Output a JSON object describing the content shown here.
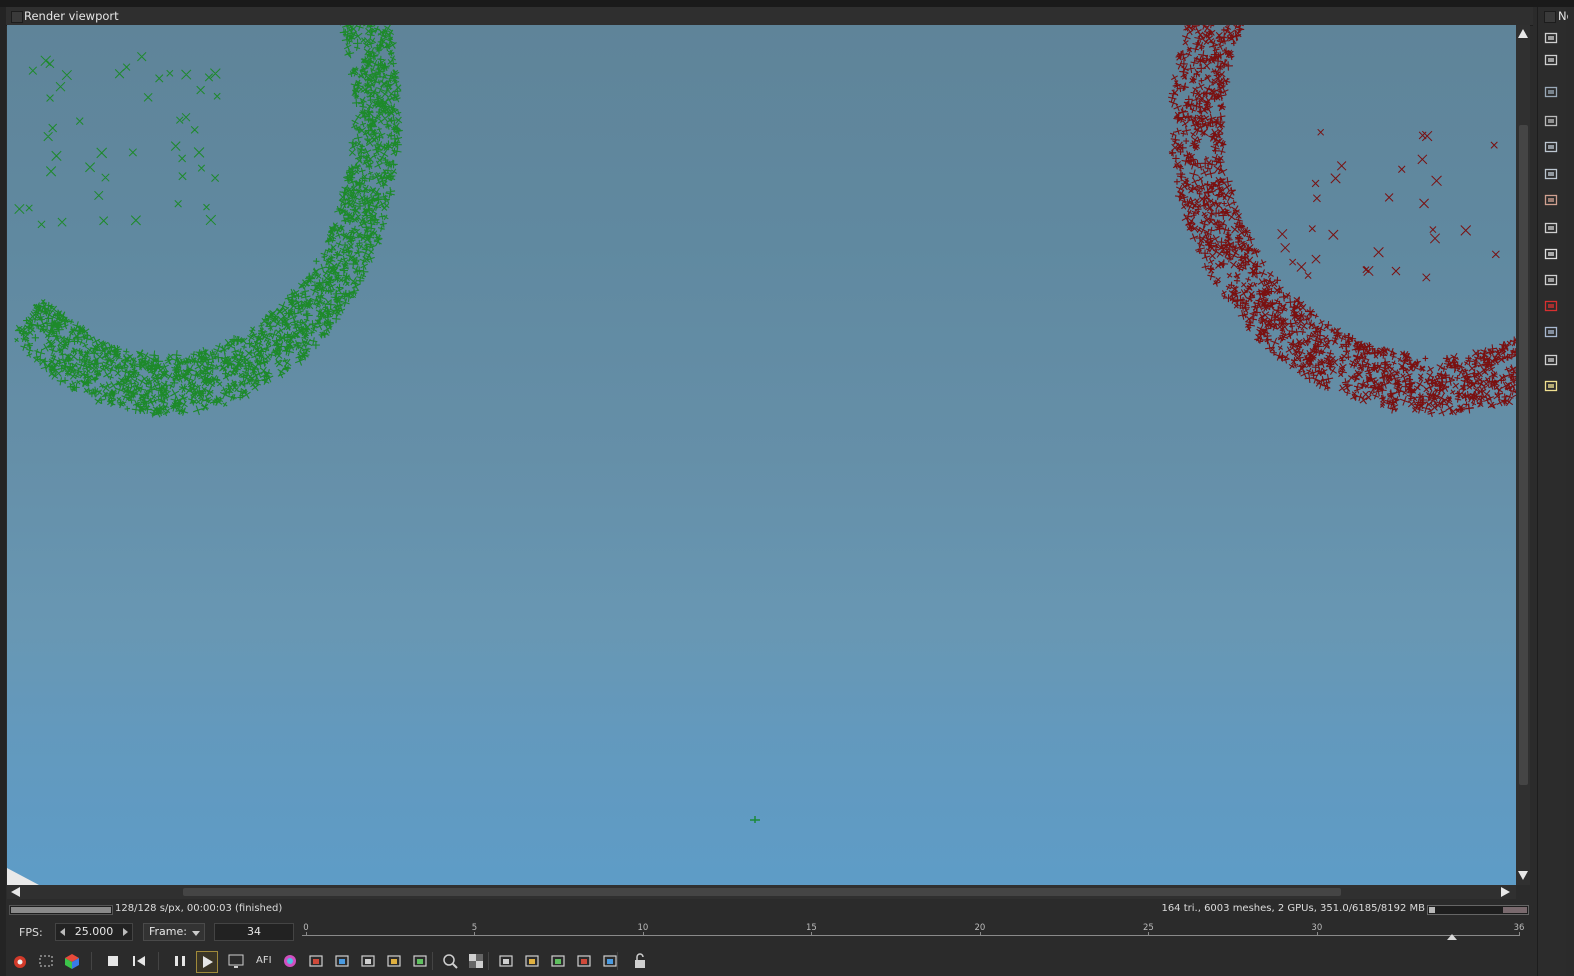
{
  "window": {
    "title": "Render viewport",
    "side_panel_title": "No"
  },
  "status": {
    "progress_fraction": 1.0,
    "samples_text": "128/128 s/px, 00:00:03 (finished)",
    "scene_info": "164 tri., 6003 meshes, 2 GPUs, 351.0/6185/8192 MB",
    "memory_used_fraction": 0.06
  },
  "timeline": {
    "fps_label": "FPS:",
    "fps_value": "25.000",
    "frame_mode": "Frame:",
    "frame_value": "34",
    "start": 0,
    "end": 36,
    "tick_labels": [
      "0",
      "5",
      "10",
      "15",
      "20",
      "25",
      "30",
      "36"
    ],
    "current_frame": 34
  },
  "toolbar": {
    "afi_label": "AFI"
  },
  "icons": {
    "right_panel": [
      "layers-icon",
      "outliner-icon",
      "image-icon",
      "material-icon",
      "node-graph-icon",
      "render-settings-icon",
      "fluid-icon",
      "camera-frame-icon",
      "clock-icon",
      "imager-icon",
      "red-cube-icon",
      "geometry-icon",
      "picture-icon",
      "light-icon"
    ],
    "bottom": [
      "fire-icon",
      "region-icon",
      "color-cube-icon",
      "stop-icon",
      "restart-icon",
      "pause-icon",
      "play-icon",
      "display-icon",
      "afi-icon",
      "color-wheel-icon",
      "refresh-icon",
      "focus-icon",
      "material-picker-icon",
      "crop-icon",
      "clay-icon",
      "zoom-icon",
      "checker-icon",
      "sampling-icon",
      "save-icon",
      "export-icon",
      "copy-icon",
      "compare-icon",
      "lock-icon"
    ]
  },
  "colors": {
    "green_particles": "#1d8a2a",
    "red_particles": "#7a1010",
    "sky_top": "#5f8499",
    "sky_bottom": "#5e9cc7"
  }
}
